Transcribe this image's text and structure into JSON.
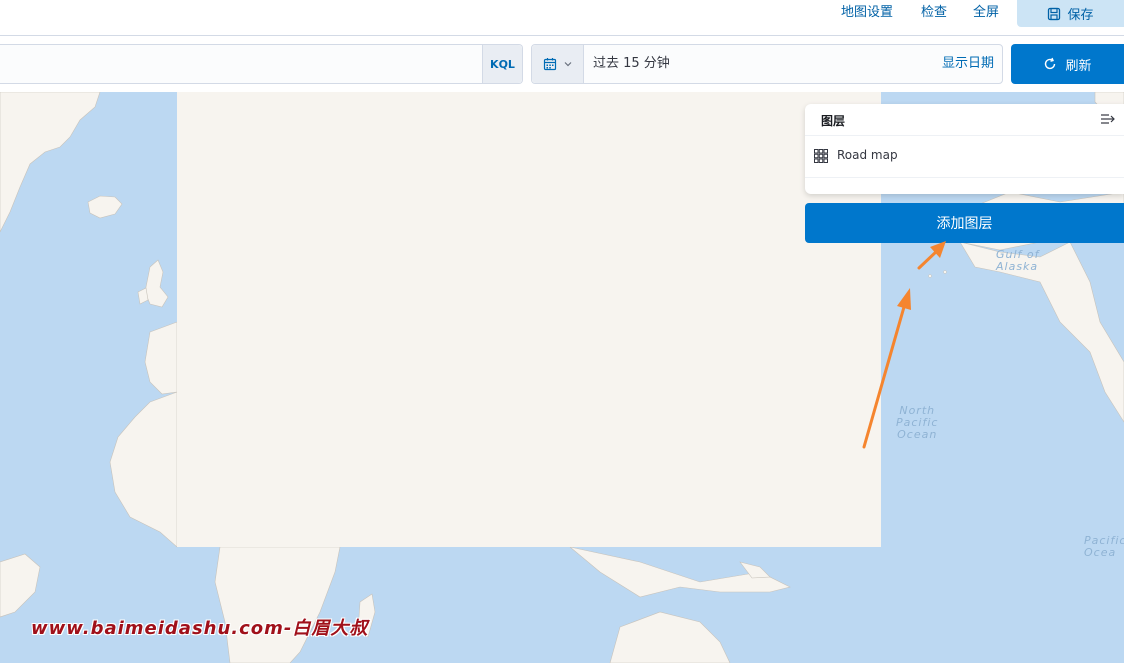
{
  "nav": {
    "map_settings": "地图设置",
    "inspect": "检查",
    "fullscreen": "全屏",
    "save": "保存"
  },
  "query": {
    "search_value": "",
    "kql": "KQL",
    "time_range": "过去 15 分钟",
    "show_dates": "显示日期",
    "refresh": "刷新"
  },
  "map": {
    "ocean_north_pacific": [
      "North",
      "Pacific",
      "Ocean"
    ],
    "ocean_pacific_right": [
      "Pacific",
      "Ocea"
    ],
    "gulf_label": [
      "Gulf of",
      "Alaska"
    ]
  },
  "layers": {
    "title": "图层",
    "items": [
      {
        "label": "Road map",
        "icon": "grid-icon"
      }
    ],
    "add_button": "添加图层"
  },
  "watermark": "www.baimeidashu.com-白眉大叔",
  "colors": {
    "accent": "#0077cc",
    "ocean": "#bcd8f2",
    "land": "#f7f4ef",
    "arrow": "#f5852f"
  }
}
